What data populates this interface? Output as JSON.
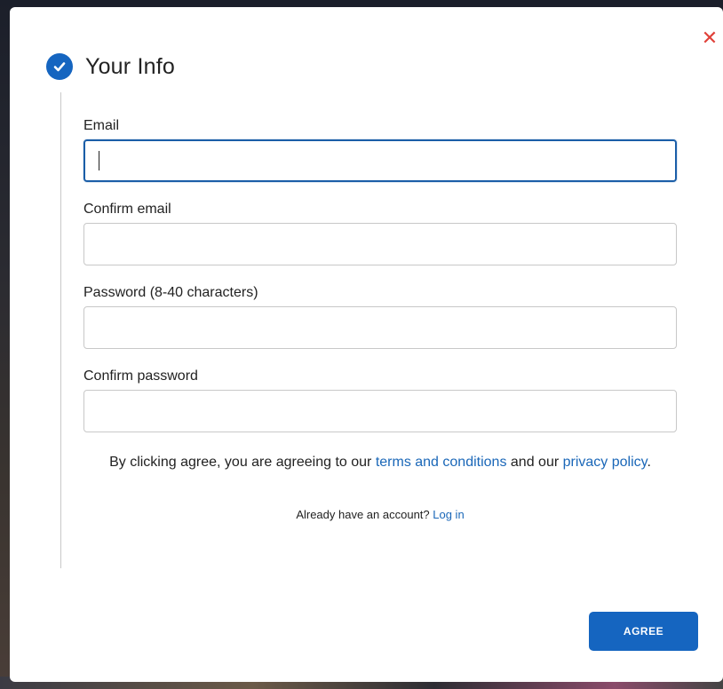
{
  "step": {
    "title": "Your Info",
    "status_icon": "check-circle-icon"
  },
  "close": {
    "glyph": "✕",
    "color": "#e0413a"
  },
  "fields": [
    {
      "label": "Email",
      "value": "",
      "focused": true
    },
    {
      "label": "Confirm email",
      "value": ""
    },
    {
      "label": "Password (8-40 characters)",
      "value": ""
    },
    {
      "label": "Confirm password",
      "value": ""
    }
  ],
  "consent": {
    "prefix": "By clicking agree, you are agreeing to our ",
    "terms_link": "terms and conditions",
    "middle": " and our ",
    "privacy_link": "privacy policy",
    "suffix": "."
  },
  "login": {
    "prompt": "Already have an account? ",
    "link": "Log in"
  },
  "agree_button": {
    "label": "AGREE"
  },
  "colors": {
    "primary": "#1565c0",
    "link": "#1a67b8",
    "focus_border": "#1b5ea8"
  }
}
